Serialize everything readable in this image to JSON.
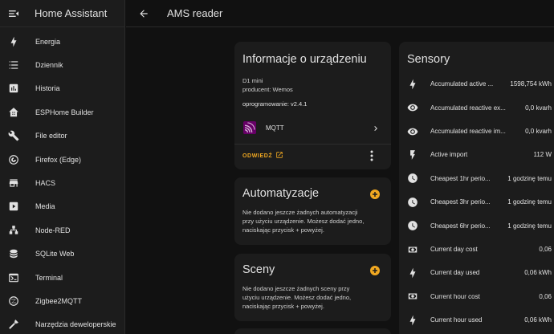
{
  "sidebar": {
    "title": "Home Assistant",
    "items": [
      {
        "label": "Energia",
        "icon": "lightning-icon"
      },
      {
        "label": "Dziennik",
        "icon": "list-icon"
      },
      {
        "label": "Historia",
        "icon": "chart-box-icon"
      },
      {
        "label": "ESPHome Builder",
        "icon": "esphome-icon"
      },
      {
        "label": "File editor",
        "icon": "wrench-icon"
      },
      {
        "label": "Firefox (Edge)",
        "icon": "firefox-icon"
      },
      {
        "label": "HACS",
        "icon": "store-icon"
      },
      {
        "label": "Media",
        "icon": "play-box-icon"
      },
      {
        "label": "Node-RED",
        "icon": "sitemap-icon"
      },
      {
        "label": "SQLite Web",
        "icon": "database-icon"
      },
      {
        "label": "Terminal",
        "icon": "console-icon"
      },
      {
        "label": "Zigbee2MQTT",
        "icon": "zigbee-icon"
      },
      {
        "label": "Narzędzia deweloperskie",
        "icon": "hammer-icon"
      }
    ]
  },
  "topbar": {
    "title": "AMS reader"
  },
  "device_info": {
    "title": "Informacje o urządzeniu",
    "model": "D1 mini",
    "manufacturer": "producent: Wemos",
    "firmware": "oprogramowanie: v2.4.1",
    "integration": "MQTT",
    "visit_label": "ODWIEDŹ"
  },
  "automations": {
    "title": "Automatyzacje",
    "text": [
      "Nie dodano jeszcze żadnych automatyzacji",
      "przy użyciu urządzenie. Możesz dodać jedno,",
      "naciskając przycisk + powyżej."
    ]
  },
  "scenes": {
    "title": "Sceny",
    "text": [
      "Nie dodano jeszcze żadnych sceny przy",
      "użyciu urządzenie. Możesz dodać jedno,",
      "naciskając przycisk + powyżej."
    ]
  },
  "sensors": {
    "title": "Sensory",
    "rows": [
      {
        "name": "Accumulated active ...",
        "value": "1598,754 kWh",
        "icon": "lightning-icon"
      },
      {
        "name": "Accumulated reactive ex...",
        "value": "0,0 kvarh",
        "icon": "eye-icon"
      },
      {
        "name": "Accumulated reactive im...",
        "value": "0,0 kvarh",
        "icon": "eye-icon"
      },
      {
        "name": "Active import",
        "value": "112 W",
        "icon": "flash-icon"
      },
      {
        "name": "Cheapest 1hr perio...",
        "value": "1 godzinę temu",
        "icon": "clock-icon"
      },
      {
        "name": "Cheapest 3hr perio...",
        "value": "1 godzinę temu",
        "icon": "clock-icon"
      },
      {
        "name": "Cheapest 6hr perio...",
        "value": "1 godzinę temu",
        "icon": "clock-icon"
      },
      {
        "name": "Current day cost",
        "value": "0,06",
        "icon": "cash-icon"
      },
      {
        "name": "Current day used",
        "value": "0,06 kWh",
        "icon": "lightning-icon"
      },
      {
        "name": "Current hour cost",
        "value": "0,06",
        "icon": "cash-icon"
      },
      {
        "name": "Current hour used",
        "value": "0,06 kWh",
        "icon": "lightning-icon"
      }
    ]
  },
  "colors": {
    "accent": "#f0a821",
    "card": "#1c1c1c",
    "background": "#111111",
    "mqtt": "#660066"
  }
}
